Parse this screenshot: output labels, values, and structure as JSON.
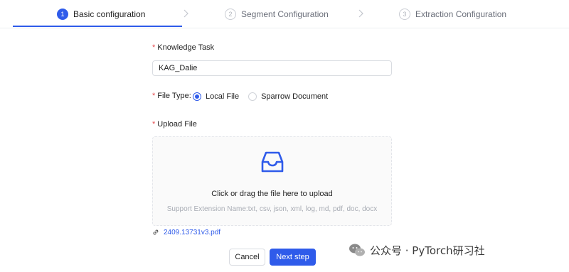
{
  "steps": [
    {
      "num": "1",
      "label": "Basic configuration",
      "active": true
    },
    {
      "num": "2",
      "label": "Segment Configuration",
      "active": false
    },
    {
      "num": "3",
      "label": "Extraction Configuration",
      "active": false
    }
  ],
  "form": {
    "required_mark": "*",
    "knowledge_task": {
      "label": "Knowledge Task",
      "value": "KAG_Dalie"
    },
    "file_type": {
      "label": "File Type:",
      "options": [
        {
          "label": "Local File",
          "checked": true
        },
        {
          "label": "Sparrow Document",
          "checked": false
        }
      ]
    },
    "upload": {
      "label": "Upload File",
      "icon": "inbox-icon",
      "text": "Click or drag the file here to upload",
      "hint": "Support Extension Name:txt, csv, json, xml, log, md, pdf, doc, docx"
    },
    "attached_file": {
      "icon": "link-icon",
      "name": "2409.13731v3.pdf"
    }
  },
  "actions": {
    "cancel_label": "Cancel",
    "next_label": "Next step"
  },
  "watermark": {
    "text": "公众号 · PyTorch研习社",
    "icon": "wechat-icon"
  },
  "colors": {
    "primary": "#2f5bea",
    "required": "#e5484d",
    "hint": "#a9adb5"
  }
}
